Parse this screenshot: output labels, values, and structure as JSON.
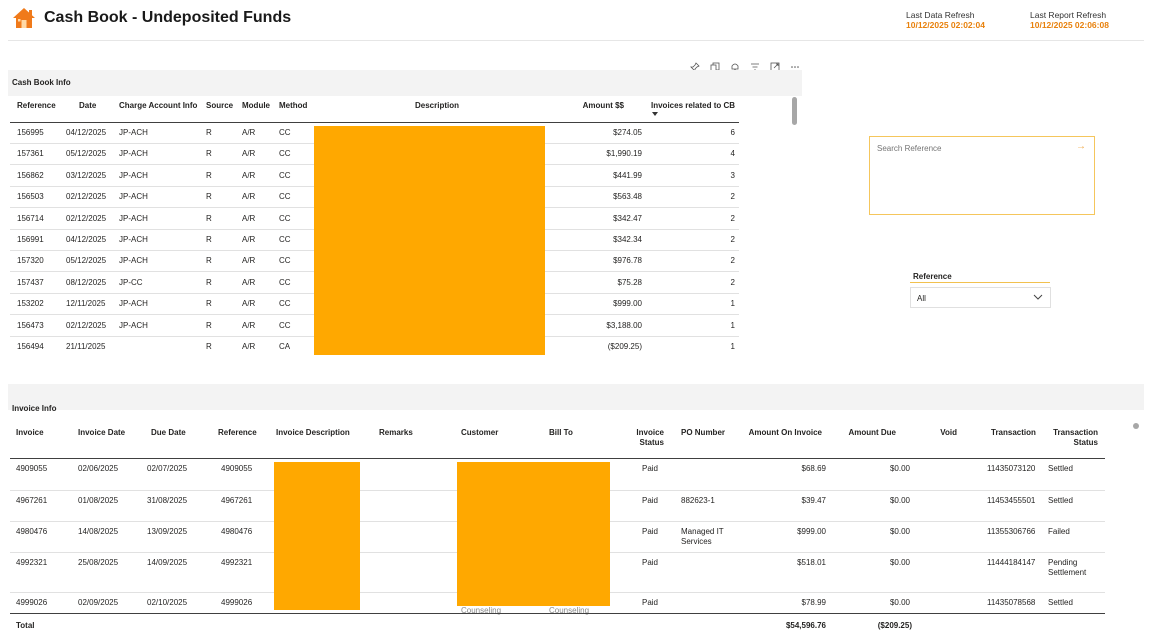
{
  "header": {
    "title": "Cash Book - Undeposited Funds",
    "last_data_refresh_label": "Last Data Refresh",
    "last_data_refresh_value": "10/12/2025 02:02:04",
    "last_report_refresh_label": "Last Report Refresh",
    "last_report_refresh_value": "10/12/2025 02:06:08",
    "accent_color": "#e8810c",
    "logo_icon": "house-icon"
  },
  "toolbar": {
    "icons": [
      "pin-icon",
      "copy-icon",
      "bell-icon",
      "filter-icon",
      "focus-mode-icon",
      "more-options-icon"
    ]
  },
  "cash_book": {
    "title": "Cash Book Info",
    "columns": [
      "Reference",
      "Date",
      "Charge Account Info",
      "Source",
      "Module",
      "Method",
      "Description",
      "Amount $$",
      "Invoices related to CB"
    ],
    "rows": [
      [
        "156995",
        "04/12/2025",
        "JP-ACH",
        "R",
        "A/R",
        "CC",
        "",
        "$274.05",
        "6"
      ],
      [
        "157361",
        "05/12/2025",
        "JP-ACH",
        "R",
        "A/R",
        "CC",
        "",
        "$1,990.19",
        "4"
      ],
      [
        "156862",
        "03/12/2025",
        "JP-ACH",
        "R",
        "A/R",
        "CC",
        "",
        "$441.99",
        "3"
      ],
      [
        "156503",
        "02/12/2025",
        "JP-ACH",
        "R",
        "A/R",
        "CC",
        "",
        "$563.48",
        "2"
      ],
      [
        "156714",
        "02/12/2025",
        "JP-ACH",
        "R",
        "A/R",
        "CC",
        "",
        "$342.47",
        "2"
      ],
      [
        "156991",
        "04/12/2025",
        "JP-ACH",
        "R",
        "A/R",
        "CC",
        "",
        "$342.34",
        "2"
      ],
      [
        "157320",
        "05/12/2025",
        "JP-ACH",
        "R",
        "A/R",
        "CC",
        "",
        "$976.78",
        "2"
      ],
      [
        "157437",
        "08/12/2025",
        "JP-CC",
        "R",
        "A/R",
        "CC",
        "",
        "$75.28",
        "2"
      ],
      [
        "153202",
        "12/11/2025",
        "JP-ACH",
        "R",
        "A/R",
        "CC",
        "",
        "$999.00",
        "1"
      ],
      [
        "156473",
        "02/12/2025",
        "JP-ACH",
        "R",
        "A/R",
        "CC",
        "",
        "$3,188.00",
        "1"
      ],
      [
        "156494",
        "21/11/2025",
        "",
        "R",
        "A/R",
        "CA",
        "",
        "($209.25)",
        "1"
      ]
    ]
  },
  "search": {
    "placeholder": "Search Reference"
  },
  "reference_slicer": {
    "label": "Reference",
    "selected": "All"
  },
  "invoice": {
    "title": "Invoice Info",
    "columns": [
      "Invoice",
      "Invoice Date",
      "Due Date",
      "Reference",
      "Invoice Description",
      "Remarks",
      "Customer",
      "Bill To",
      "Invoice Status",
      "PO Number",
      "Amount On Invoice",
      "Amount Due",
      "Void",
      "Transaction",
      "Transaction Status"
    ],
    "rows": [
      [
        "4909055",
        "02/06/2025",
        "02/07/2025",
        "4909055",
        "",
        "",
        "",
        "",
        "Paid",
        "",
        "$68.69",
        "$0.00",
        "",
        "11435073120",
        "Settled"
      ],
      [
        "4967261",
        "01/08/2025",
        "31/08/2025",
        "4967261",
        "",
        "",
        "",
        "",
        "Paid",
        "882623-1",
        "$39.47",
        "$0.00",
        "",
        "11453455501",
        "Settled"
      ],
      [
        "4980476",
        "14/08/2025",
        "13/09/2025",
        "4980476",
        "",
        "",
        "",
        "",
        "Paid",
        "Managed IT Services",
        "$999.00",
        "$0.00",
        "",
        "11355306766",
        "Failed"
      ],
      [
        "4992321",
        "25/08/2025",
        "14/09/2025",
        "4992321",
        "",
        "",
        "",
        "",
        "Paid",
        "",
        "$518.01",
        "$0.00",
        "",
        "11444184147",
        "Pending Settlement"
      ],
      [
        "4999026",
        "02/09/2025",
        "02/10/2025",
        "4999026",
        "",
        "",
        "Counseling",
        "Counseling",
        "Paid",
        "",
        "$78.99",
        "$0.00",
        "",
        "11435078568",
        "Settled"
      ]
    ],
    "total_label": "Total",
    "total_amount_on_invoice": "$54,596.76",
    "total_amount_due": "($209.25)"
  },
  "colors": {
    "redaction": "#ffa800",
    "search_border": "#f5c65c"
  }
}
